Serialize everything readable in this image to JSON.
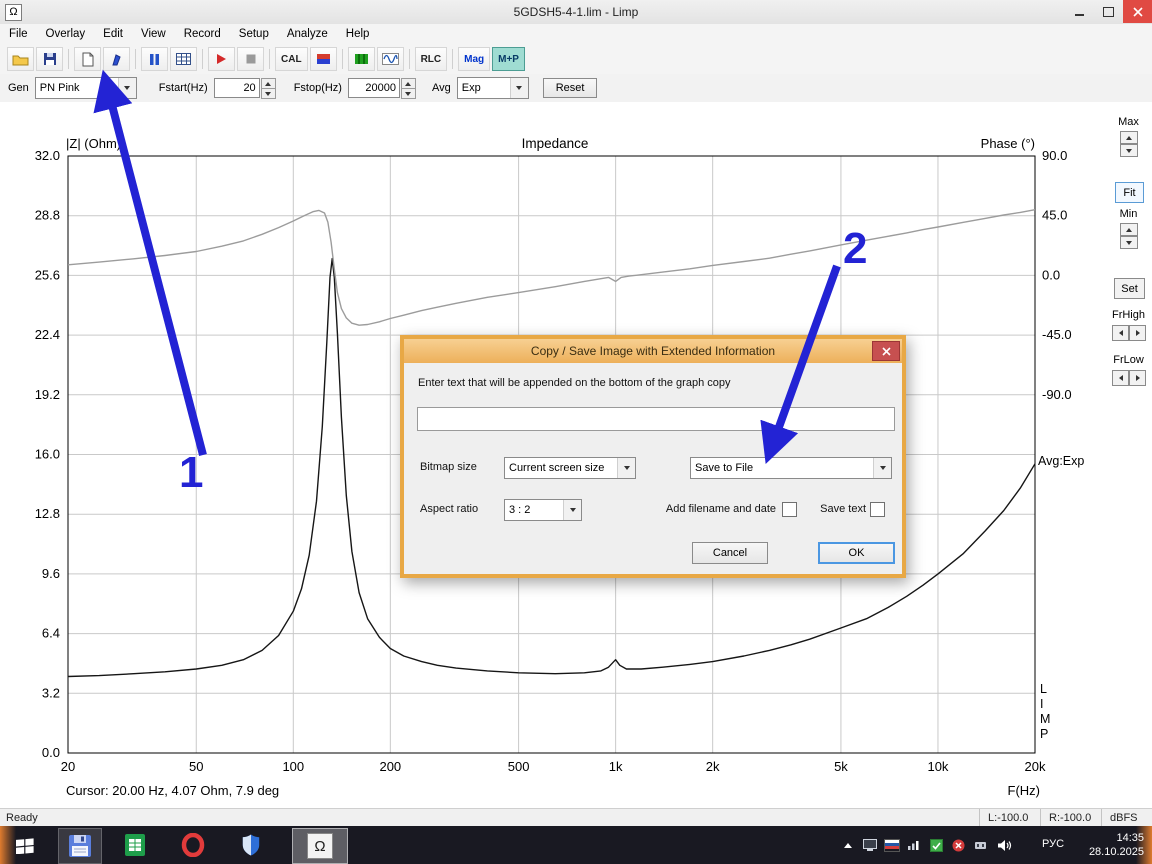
{
  "titlebar": {
    "title": "5GDSH5-4-1.lim - Limp"
  },
  "icons": {
    "omega": "Ω"
  },
  "menu": {
    "items": [
      "File",
      "Overlay",
      "Edit",
      "View",
      "Record",
      "Setup",
      "Analyze",
      "Help"
    ]
  },
  "toolbar": {
    "cal": "CAL",
    "rlc": "RLC",
    "mag": "Mag",
    "mp": "M+P"
  },
  "controls": {
    "gen_label": "Gen",
    "gen_value": "PN Pink",
    "fstart_label": "Fstart(Hz)",
    "fstart_value": "20",
    "fstop_label": "Fstop(Hz)",
    "fstop_value": "20000",
    "avg_label": "Avg",
    "avg_value": "Exp",
    "reset_label": "Reset"
  },
  "right_panel": {
    "max_label": "Max",
    "fit_label": "Fit",
    "min_label": "Min",
    "set_label": "Set",
    "frhigh_label": "FrHigh",
    "frlow_label": "FrLow"
  },
  "avg_indicator": "Avg:Exp",
  "limp": [
    "L",
    "I",
    "M",
    "P"
  ],
  "cursor_text": "Cursor: 20.00 Hz, 4.07 Ohm, 7.9 deg",
  "chart_data": {
    "type": "line",
    "title": "Impedance",
    "left_axis_label": "|Z| (Ohm)",
    "right_axis_label": "Phase (°)",
    "x_label": "F(Hz)",
    "x_scale": "log",
    "x_range": [
      20,
      20000
    ],
    "x_ticks": [
      "20",
      "50",
      "100",
      "200",
      "500",
      "1k",
      "2k",
      "5k",
      "10k",
      "20k"
    ],
    "x_tick_values": [
      20,
      50,
      100,
      200,
      500,
      1000,
      2000,
      5000,
      10000,
      20000
    ],
    "left_range": [
      0,
      32
    ],
    "left_ticks": [
      32,
      28.8,
      25.6,
      22.4,
      19.2,
      16,
      12.8,
      9.6,
      6.4,
      3.2,
      0
    ],
    "right_ticks": [
      90,
      45,
      0,
      -45,
      -90
    ],
    "grid": true,
    "legend": "none",
    "series": [
      {
        "name": "impedance-curve",
        "label": "Impedance (Ohm)",
        "axis": "left",
        "color": "#161616",
        "points": [
          [
            20,
            4.1
          ],
          [
            25,
            4.15
          ],
          [
            32,
            4.25
          ],
          [
            40,
            4.35
          ],
          [
            50,
            4.5
          ],
          [
            60,
            4.7
          ],
          [
            70,
            5.0
          ],
          [
            80,
            5.5
          ],
          [
            90,
            6.3
          ],
          [
            100,
            7.6
          ],
          [
            106,
            8.8
          ],
          [
            112,
            10.6
          ],
          [
            118,
            13.5
          ],
          [
            123,
            17.5
          ],
          [
            127,
            22.0
          ],
          [
            130,
            25.5
          ],
          [
            132,
            26.5
          ],
          [
            134,
            25.5
          ],
          [
            137,
            22.5
          ],
          [
            141,
            18.0
          ],
          [
            146,
            13.8
          ],
          [
            152,
            10.8
          ],
          [
            160,
            8.6
          ],
          [
            170,
            7.2
          ],
          [
            185,
            6.2
          ],
          [
            200,
            5.6
          ],
          [
            220,
            5.2
          ],
          [
            250,
            4.9
          ],
          [
            280,
            4.7
          ],
          [
            320,
            4.55
          ],
          [
            400,
            4.4
          ],
          [
            500,
            4.3
          ],
          [
            650,
            4.25
          ],
          [
            800,
            4.3
          ],
          [
            900,
            4.4
          ],
          [
            950,
            4.6
          ],
          [
            1000,
            5.0
          ],
          [
            1030,
            4.7
          ],
          [
            1080,
            4.5
          ],
          [
            1200,
            4.5
          ],
          [
            1400,
            4.6
          ],
          [
            1700,
            4.75
          ],
          [
            2000,
            4.9
          ],
          [
            2500,
            5.2
          ],
          [
            3000,
            5.5
          ],
          [
            3500,
            5.8
          ],
          [
            4000,
            6.1
          ],
          [
            5000,
            6.7
          ],
          [
            6000,
            7.2
          ],
          [
            7000,
            7.8
          ],
          [
            8000,
            8.4
          ],
          [
            9000,
            9.0
          ],
          [
            10000,
            9.6
          ],
          [
            12000,
            10.7
          ],
          [
            14000,
            11.9
          ],
          [
            16000,
            13.0
          ],
          [
            18000,
            14.2
          ],
          [
            20000,
            15.5
          ]
        ]
      },
      {
        "name": "phase-curve",
        "label": "Phase (deg)",
        "axis": "right",
        "color": "#9c9c9c",
        "points": [
          [
            20,
            8
          ],
          [
            25,
            10
          ],
          [
            32,
            12.5
          ],
          [
            40,
            15
          ],
          [
            50,
            18
          ],
          [
            60,
            22
          ],
          [
            70,
            26
          ],
          [
            80,
            31
          ],
          [
            90,
            36
          ],
          [
            100,
            41
          ],
          [
            108,
            45
          ],
          [
            115,
            48
          ],
          [
            120,
            49
          ],
          [
            125,
            47
          ],
          [
            128,
            40
          ],
          [
            131,
            25
          ],
          [
            134,
            5
          ],
          [
            137,
            -13
          ],
          [
            141,
            -25
          ],
          [
            146,
            -32
          ],
          [
            152,
            -36
          ],
          [
            160,
            -37.5
          ],
          [
            170,
            -37
          ],
          [
            185,
            -35
          ],
          [
            200,
            -32.5
          ],
          [
            220,
            -30
          ],
          [
            250,
            -26.5
          ],
          [
            280,
            -24
          ],
          [
            320,
            -21
          ],
          [
            400,
            -16.5
          ],
          [
            500,
            -13
          ],
          [
            650,
            -8.5
          ],
          [
            800,
            -4.5
          ],
          [
            900,
            -2.5
          ],
          [
            950,
            -1.5
          ],
          [
            1000,
            -4.5
          ],
          [
            1040,
            -1.5
          ],
          [
            1100,
            -0.5
          ],
          [
            1200,
            0.5
          ],
          [
            1400,
            2.5
          ],
          [
            1700,
            5
          ],
          [
            2000,
            7.5
          ],
          [
            2500,
            10.5
          ],
          [
            3000,
            13
          ],
          [
            3500,
            16
          ],
          [
            4000,
            18.5
          ],
          [
            5000,
            23
          ],
          [
            6000,
            26.5
          ],
          [
            7000,
            29.5
          ],
          [
            8000,
            32
          ],
          [
            9000,
            34.5
          ],
          [
            10000,
            36.5
          ],
          [
            12000,
            40
          ],
          [
            14000,
            43
          ],
          [
            16000,
            45.5
          ],
          [
            18000,
            47.5
          ],
          [
            20000,
            49.5
          ]
        ]
      }
    ]
  },
  "dialog": {
    "title": "Copy / Save Image with Extended Information",
    "instruction": "Enter text that will be appended on the bottom of the graph copy",
    "append_text_value": "",
    "bitmap_size_label": "Bitmap size",
    "bitmap_size_value": "Current screen size",
    "save_destination_value": "Save to File",
    "aspect_ratio_label": "Aspect ratio",
    "aspect_ratio_value": "3 : 2",
    "add_filename_label": "Add filename and date",
    "save_text_label": "Save text",
    "cancel_label": "Cancel",
    "ok_label": "OK"
  },
  "annotations": {
    "step1": "1",
    "step2": "2"
  },
  "statusbar": {
    "ready": "Ready",
    "left_level": "L:-100.0",
    "right_level": "R:-100.0",
    "units": "dBFS"
  },
  "taskbar": {
    "lang": "РУС",
    "time": "14:35",
    "date": "28.10.2025"
  }
}
